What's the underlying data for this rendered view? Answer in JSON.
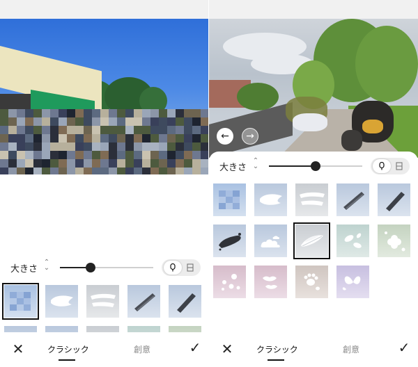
{
  "panels": {
    "left": {
      "size_label": "大きさ",
      "slider_value": 0.33,
      "tabs": [
        "クラシック",
        "創意"
      ],
      "active_tab": "クラシック"
    },
    "right": {
      "size_label": "大きさ",
      "slider_value": 0.5,
      "tabs": [
        "クラシック",
        "創意"
      ],
      "active_tab": "クラシック",
      "nav_prev_icon": "arrow-left-icon",
      "nav_next_icon": "arrow-right-icon"
    }
  },
  "icons": {
    "close": "close-icon",
    "confirm": "check-icon",
    "size_adjust": "chevron-updown-icon",
    "mode_pen": "pen-tip-icon",
    "mode_eraser": "eraser-icon"
  },
  "brushes": [
    {
      "name": "pixel-mosaic",
      "selected_on_left": true
    },
    {
      "name": "paint-stroke-white"
    },
    {
      "name": "paint-stroke-double"
    },
    {
      "name": "chalk-stroke-dark"
    },
    {
      "name": "marker-stroke-dark"
    },
    {
      "name": "ink-splash-dark"
    },
    {
      "name": "clouds"
    },
    {
      "name": "feathers",
      "selected_on_right": true
    },
    {
      "name": "leaves"
    },
    {
      "name": "clover-flowers"
    },
    {
      "name": "sakura-petals"
    },
    {
      "name": "lips"
    },
    {
      "name": "paw-prints"
    },
    {
      "name": "butterflies"
    }
  ],
  "colors": {
    "accent": "#111111",
    "sheet": "#ffffff",
    "awning_green": "#1f9a5c"
  }
}
